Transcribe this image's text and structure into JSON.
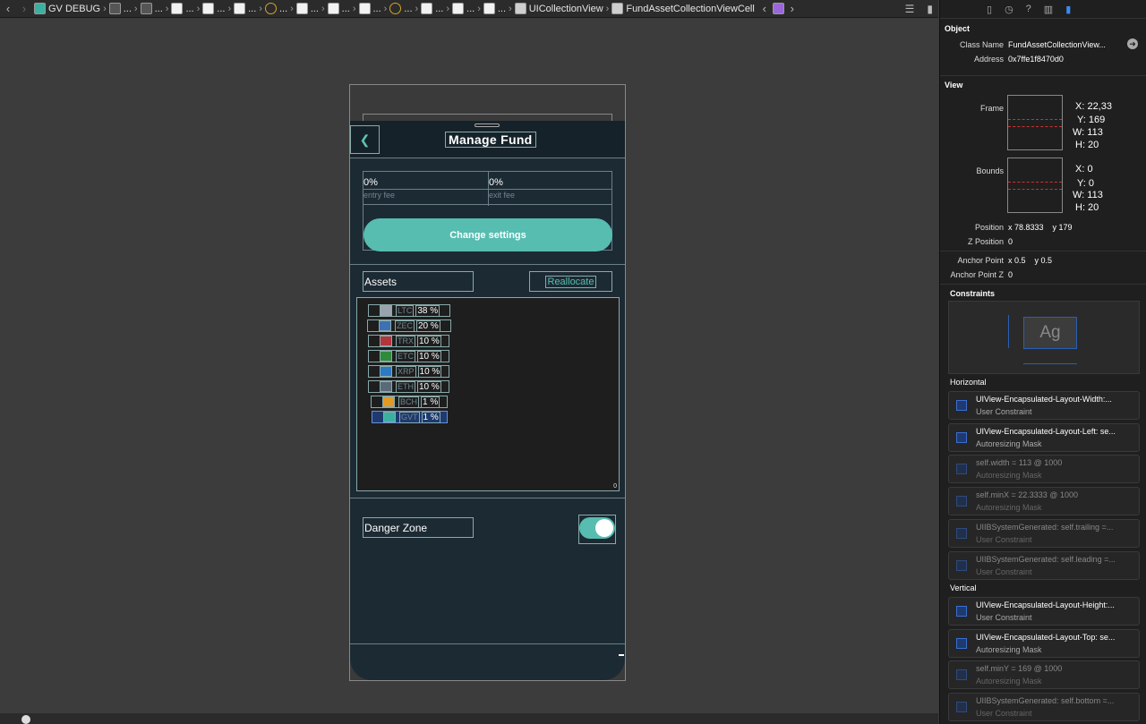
{
  "breadcrumb": {
    "app": "GV DEBUG",
    "ellipsis": "...",
    "collection": "UICollectionView",
    "cell": "FundAssetCollectionViewCell"
  },
  "app": {
    "nav_title": "Manage Fund",
    "entry_fee_value": "0%",
    "entry_fee_label": "entry fee",
    "exit_fee_value": "0%",
    "exit_fee_label": "exit fee",
    "change_settings": "Change settings",
    "assets_label": "Assets",
    "reallocate": "Reallocate",
    "assets": [
      {
        "symbol": "LTC",
        "percent": "38 %",
        "color": "#9aa3ad"
      },
      {
        "symbol": "ZEC",
        "percent": "20 %",
        "color": "#3f6fb5"
      },
      {
        "symbol": "TRX",
        "percent": "10 %",
        "color": "#b3363c"
      },
      {
        "symbol": "ETC",
        "percent": "10 %",
        "color": "#2f8a3c"
      },
      {
        "symbol": "XRP",
        "percent": "10 %",
        "color": "#2b7ac2"
      },
      {
        "symbol": "ETH",
        "percent": "10 %",
        "color": "#5a6a78"
      },
      {
        "symbol": "BCH",
        "percent": "1 %",
        "color": "#e29a24"
      },
      {
        "symbol": "GVT",
        "percent": "1 %",
        "color": "#3bb0a0"
      }
    ],
    "collection_count": "0",
    "danger_zone": "Danger Zone"
  },
  "inspector": {
    "object_title": "Object",
    "class_name_label": "Class Name",
    "class_name": "FundAssetCollectionView...",
    "address_label": "Address",
    "address": "0x7ffe1f8470d0",
    "view_title": "View",
    "frame_label": "Frame",
    "frame": {
      "x": "X: 22,33",
      "y": "Y: 169",
      "w": "W: 113",
      "h": "H: 20"
    },
    "bounds_label": "Bounds",
    "bounds": {
      "x": "X: 0",
      "y": "Y: 0",
      "w": "W: 113",
      "h": "H: 20"
    },
    "position_label": "Position",
    "position": "x 78.8333    y 179",
    "zposition_label": "Z Position",
    "zposition": "0",
    "anchor_label": "Anchor Point",
    "anchor": "x 0.5    y 0.5",
    "anchorz_label": "Anchor Point Z",
    "anchorz": "0",
    "constraints_title": "Constraints",
    "ag_text": "Ag",
    "horizontal_label": "Horizontal",
    "vertical_label": "Vertical",
    "horizontal": [
      {
        "title": "UIView-Encapsulated-Layout-Width:...",
        "sub": "User Constraint",
        "dim": false
      },
      {
        "title": "UIView-Encapsulated-Layout-Left: se...",
        "sub": "Autoresizing Mask",
        "dim": false
      },
      {
        "title": "self.width = 113 @ 1000",
        "sub": "Autoresizing Mask",
        "dim": true
      },
      {
        "title": "self.minX = 22.3333 @ 1000",
        "sub": "Autoresizing Mask",
        "dim": true
      },
      {
        "title": "UIIBSystemGenerated: self.trailing =...",
        "sub": "User Constraint",
        "dim": true
      },
      {
        "title": "UIIBSystemGenerated: self.leading =...",
        "sub": "User Constraint",
        "dim": true
      }
    ],
    "vertical": [
      {
        "title": "UIView-Encapsulated-Layout-Height:...",
        "sub": "User Constraint",
        "dim": false
      },
      {
        "title": "UIView-Encapsulated-Layout-Top: se...",
        "sub": "Autoresizing Mask",
        "dim": false
      },
      {
        "title": "self.minY = 169 @ 1000",
        "sub": "Autoresizing Mask",
        "dim": true
      },
      {
        "title": "UIIBSystemGenerated: self.bottom =...",
        "sub": "User Constraint",
        "dim": true
      }
    ]
  },
  "colors": {
    "accent_teal": "#56bdb0",
    "inspector_blue": "#3a8cf0"
  }
}
